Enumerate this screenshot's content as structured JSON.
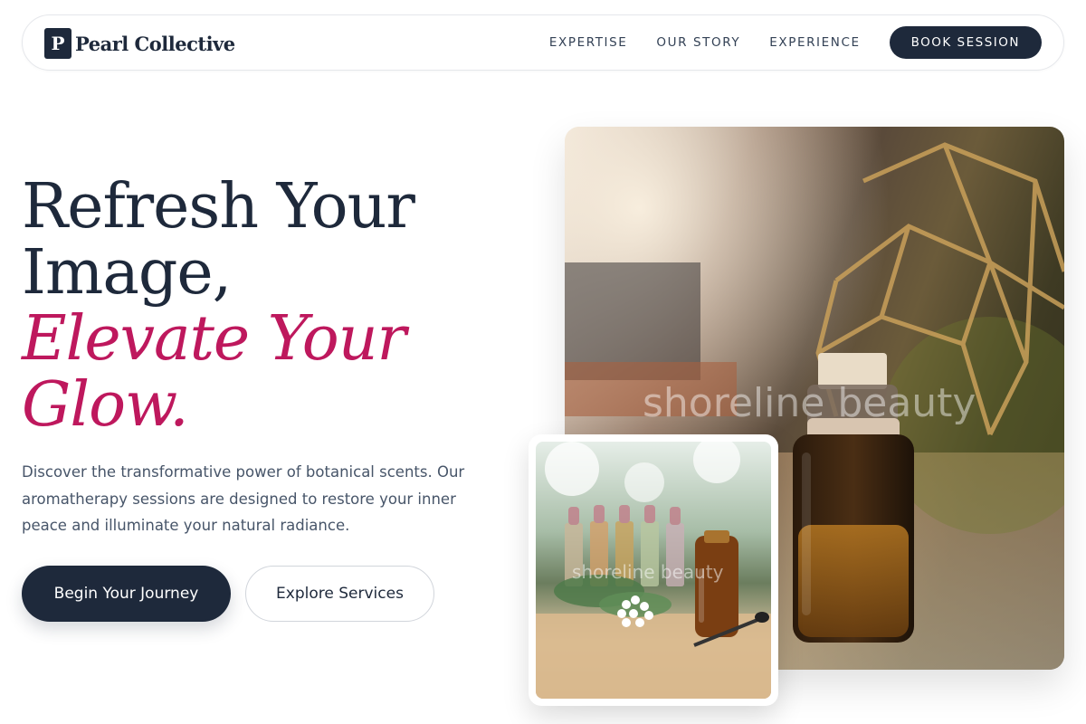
{
  "header": {
    "brand_mark": "P",
    "brand_name": "Pearl Collective",
    "nav": [
      {
        "label": "EXPERTISE"
      },
      {
        "label": "OUR STORY"
      },
      {
        "label": "EXPERIENCE"
      }
    ],
    "cta_label": "BOOK SESSION"
  },
  "hero": {
    "title_line1": "Refresh Your",
    "title_line2": "Image,",
    "accent_line1": "Elevate Your",
    "accent_line2": "Glow.",
    "description": "Discover the transformative power of botanical scents. Our aromatherapy sessions are designed to restore your inner peace and illuminate your natural radiance.",
    "primary_button": "Begin Your Journey",
    "secondary_button": "Explore Services"
  },
  "images": {
    "main_watermark": "shoreline beauty",
    "inset_watermark": "shoreline beauty"
  },
  "colors": {
    "navy": "#1e293b",
    "accent": "#be185d"
  }
}
